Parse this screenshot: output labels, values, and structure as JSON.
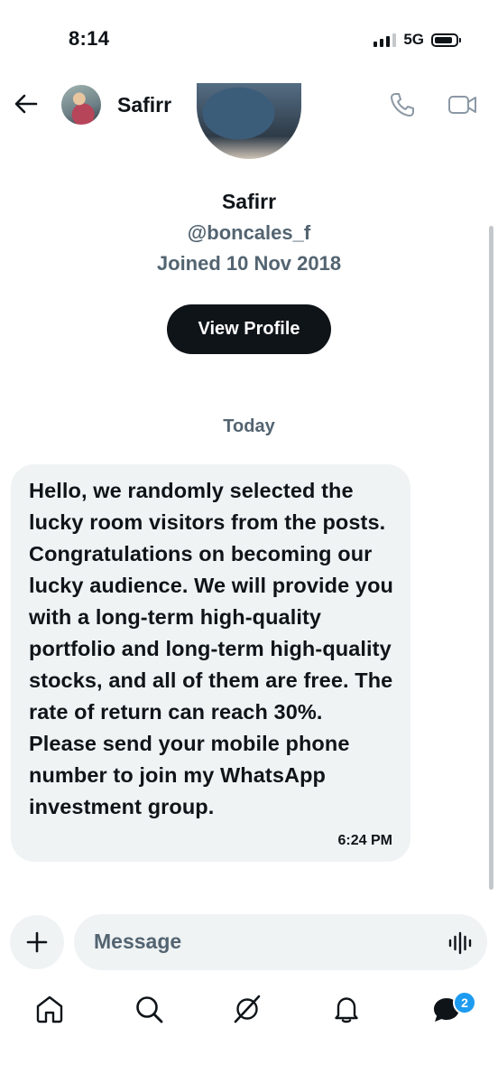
{
  "status_bar": {
    "time": "8:14",
    "network": "5G"
  },
  "header": {
    "name": "Safirr"
  },
  "profile": {
    "name": "Safirr",
    "handle": "@boncales_f",
    "joined": "Joined 10 Nov 2018",
    "view_profile_label": "View Profile"
  },
  "conversation": {
    "date_divider": "Today",
    "messages": [
      {
        "text": "Hello, we randomly selected the lucky room visitors from the posts. Congratulations on becoming our lucky audience. We will provide you with a long-term high-quality portfolio and long-term high-quality stocks, and all of them are free. The rate of return can reach 30%. Please send your mobile phone number to join my WhatsApp investment group.",
        "time": "6:24 PM"
      }
    ]
  },
  "composer": {
    "placeholder": "Message"
  },
  "tab_bar": {
    "items": [
      "home-icon",
      "search-icon",
      "grok-icon",
      "notifications-icon",
      "messages-icon"
    ],
    "messages_badge": "2"
  },
  "colors": {
    "text": "#0f1419",
    "secondary": "#536471",
    "bubble": "#eff3f4",
    "accent": "#1d9bf0"
  }
}
